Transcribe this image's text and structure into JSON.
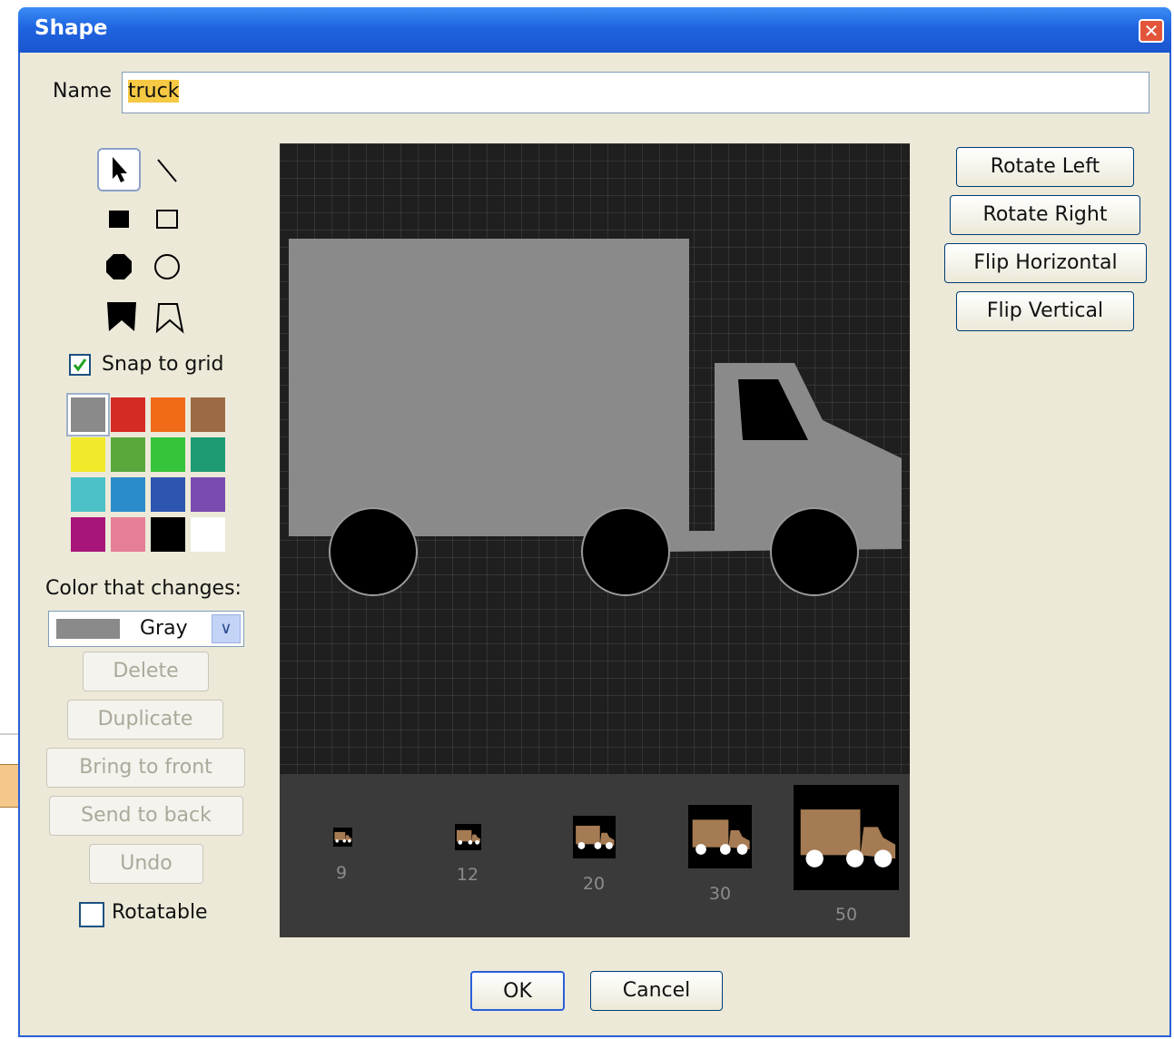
{
  "window": {
    "title": "Shape",
    "close_icon": "close-icon"
  },
  "name_field": {
    "label": "Name",
    "value": "truck"
  },
  "tools": [
    {
      "name": "select",
      "icon": "arrow-pointer-icon",
      "selected": true
    },
    {
      "name": "line",
      "icon": "line-icon"
    },
    {
      "name": "filled-rectangle",
      "icon": "filled-square-icon"
    },
    {
      "name": "outline-rectangle",
      "icon": "outline-square-icon"
    },
    {
      "name": "filled-octagon",
      "icon": "filled-octagon-icon"
    },
    {
      "name": "outline-circle",
      "icon": "outline-circle-icon"
    },
    {
      "name": "filled-polygon",
      "icon": "filled-polygon-icon"
    },
    {
      "name": "outline-polygon",
      "icon": "outline-polygon-icon"
    }
  ],
  "snap_to_grid": {
    "label": "Snap to grid",
    "checked": true
  },
  "palette": [
    "#8a8a8a",
    "#d62a24",
    "#f06a17",
    "#9c6b45",
    "#f0ea2a",
    "#5aa83c",
    "#36c43a",
    "#1e9b74",
    "#4cc2c8",
    "#2c8ccb",
    "#2c56b0",
    "#7a4cb0",
    "#a8157a",
    "#e57f95",
    "#000000",
    "#ffffff"
  ],
  "selected_color": "#8a8a8a",
  "color_that_changes": {
    "label": "Color that changes:",
    "value": "Gray",
    "swatch": "#8a8a8a"
  },
  "edit_buttons": {
    "delete": "Delete",
    "duplicate": "Duplicate",
    "bring_to_front": "Bring to front",
    "send_to_back": "Send to back",
    "undo": "Undo"
  },
  "rotatable": {
    "label": "Rotatable",
    "checked": false
  },
  "transform_buttons": {
    "rotate_left": "Rotate Left",
    "rotate_right": "Rotate Right",
    "flip_horizontal": "Flip Horizontal",
    "flip_vertical": "Flip Vertical"
  },
  "canvas": {
    "background": "#1f1f1f",
    "grid": true,
    "shape_color": "#8a8a8a"
  },
  "previews": {
    "sizes": [
      "9",
      "12",
      "20",
      "30",
      "50"
    ],
    "color": "#a57b54"
  },
  "dialog_buttons": {
    "ok": "OK",
    "cancel": "Cancel"
  }
}
